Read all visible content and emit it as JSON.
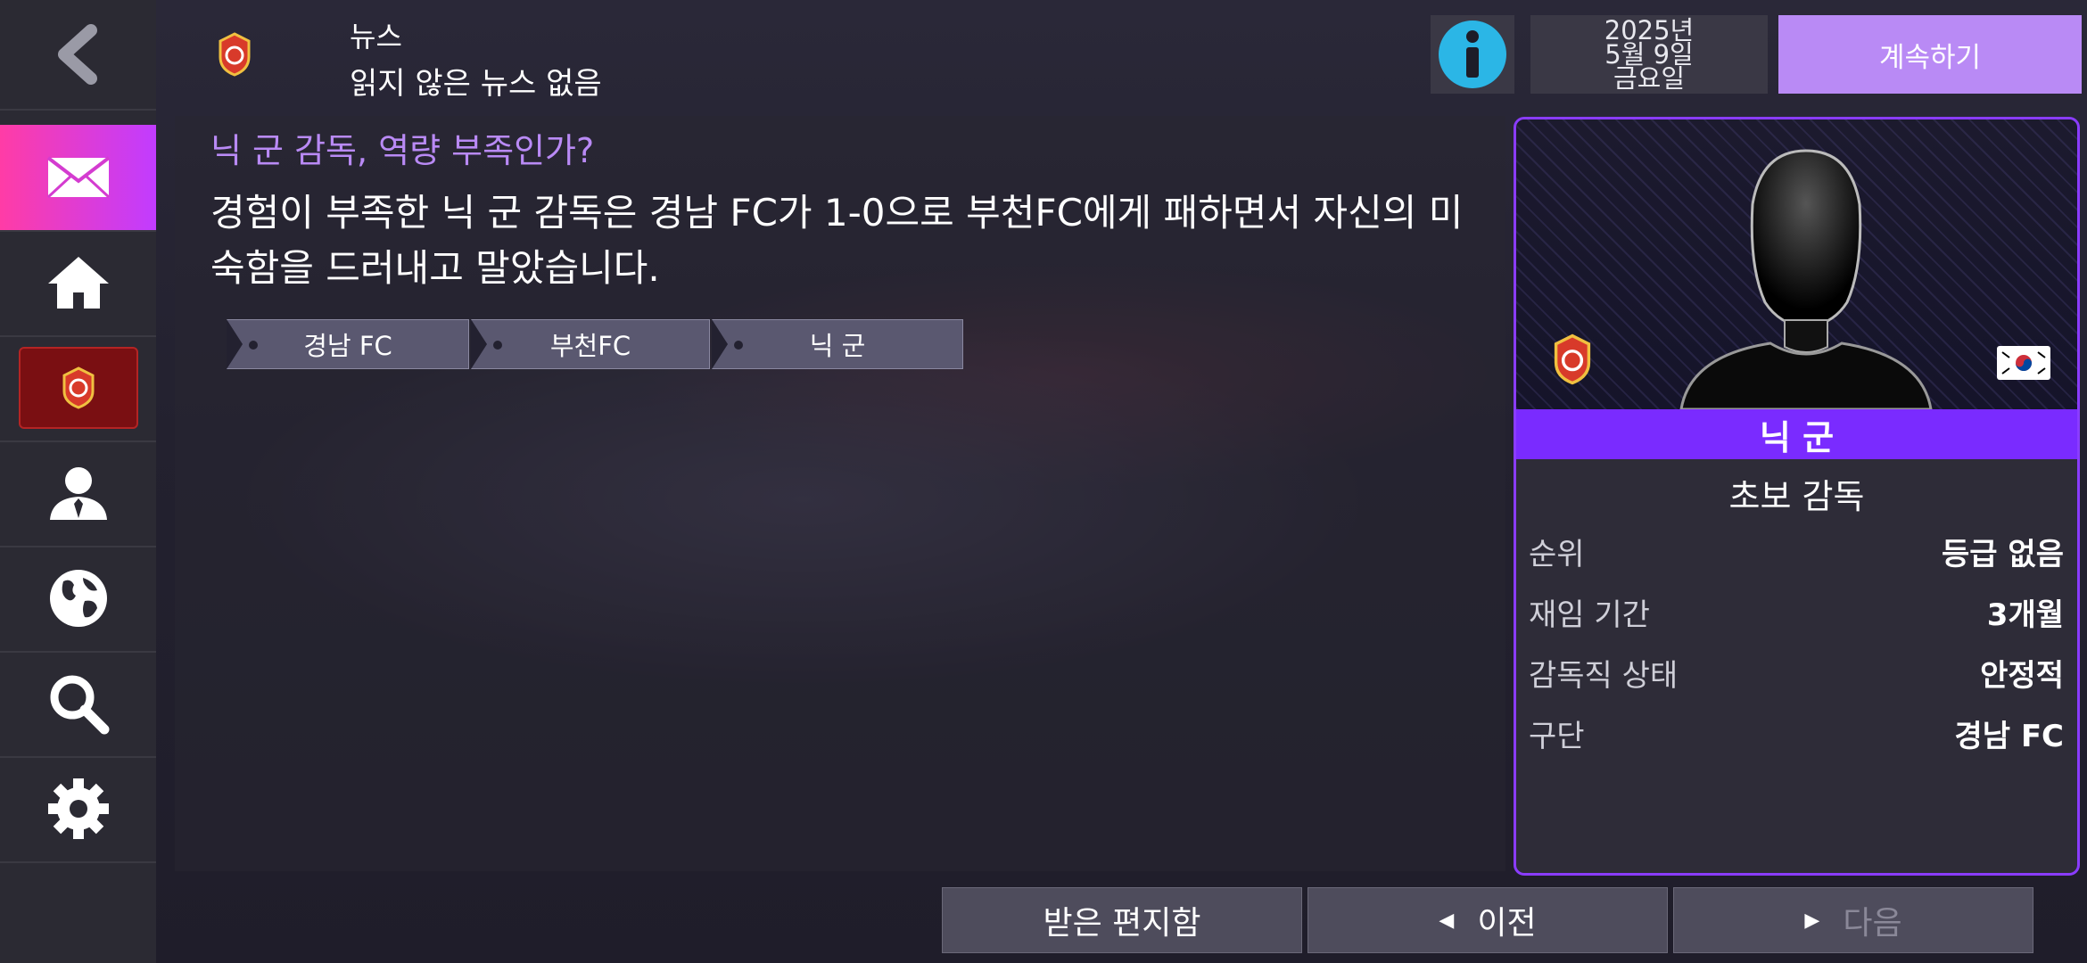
{
  "header": {
    "title": "뉴스",
    "subtitle": "읽지 않은 뉴스 없음",
    "info_icon": "info-icon",
    "date": {
      "year": "2025년",
      "day": "5월 9일",
      "weekday": "금요일"
    },
    "continue_label": "계속하기"
  },
  "sidebar": {
    "items": [
      {
        "icon": "back-arrow-icon"
      },
      {
        "icon": "mail-icon",
        "active": true
      },
      {
        "icon": "home-icon"
      },
      {
        "icon": "club-badge-icon"
      },
      {
        "icon": "person-icon"
      },
      {
        "icon": "globe-icon"
      },
      {
        "icon": "search-icon"
      },
      {
        "icon": "gear-icon"
      }
    ]
  },
  "news": {
    "headline": "닉 군 감독, 역량 부족인가?",
    "body": "경험이 부족한 닉 군 감독은 경남 FC가 1-0으로 부천FC에게 패하면서 자신의 미숙함을 드러내고 말았습니다.",
    "tags": [
      "경남 FC",
      "부천FC",
      "닉 군"
    ]
  },
  "profile": {
    "name": "닉 군",
    "role": "초보 감독",
    "stats": [
      {
        "label": "순위",
        "value": "등급 없음"
      },
      {
        "label": "재임 기간",
        "value": "3개월"
      },
      {
        "label": "감독직 상태",
        "value": "안정적"
      },
      {
        "label": "구단",
        "value": "경남 FC"
      }
    ]
  },
  "footer": {
    "inbox_label": "받은 편지함",
    "prev_label": "이전",
    "next_label": "다음"
  },
  "colors": {
    "accent_purple": "#b98af5",
    "active_gradient_start": "#ff3ca6",
    "active_gradient_end": "#c13cff",
    "name_bar": "#7a2bff"
  }
}
